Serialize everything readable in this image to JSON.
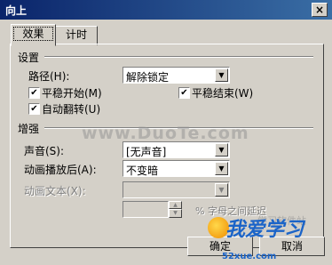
{
  "window": {
    "title": "向上",
    "close_glyph": "×"
  },
  "tabs": [
    {
      "label": "效果"
    },
    {
      "label": "计时"
    }
  ],
  "settings": {
    "group_label": "设置",
    "path_label": "路径(H):",
    "path_value": "解除锁定",
    "smooth_start_label": "平稳开始(M)",
    "smooth_start_checked": true,
    "smooth_end_label": "平稳结束(W)",
    "smooth_end_checked": true,
    "auto_reverse_label": "自动翻转(U)",
    "auto_reverse_checked": true,
    "check_glyph": "✔"
  },
  "enhancements": {
    "group_label": "增强",
    "sound_label": "声音(S):",
    "sound_value": "[无声音]",
    "after_anim_label": "动画播放后(A):",
    "after_anim_value": "不变暗",
    "anim_text_label": "动画文本(X):",
    "anim_text_value": "",
    "delay_suffix": "% 字母之间延迟"
  },
  "buttons": {
    "ok": "确定",
    "cancel": "取消"
  },
  "watermarks": {
    "center": "www.DuoTe.com",
    "logo": "我爱学习",
    "logo_sub": "52xue.com",
    "bg_text": "学习软件站"
  }
}
